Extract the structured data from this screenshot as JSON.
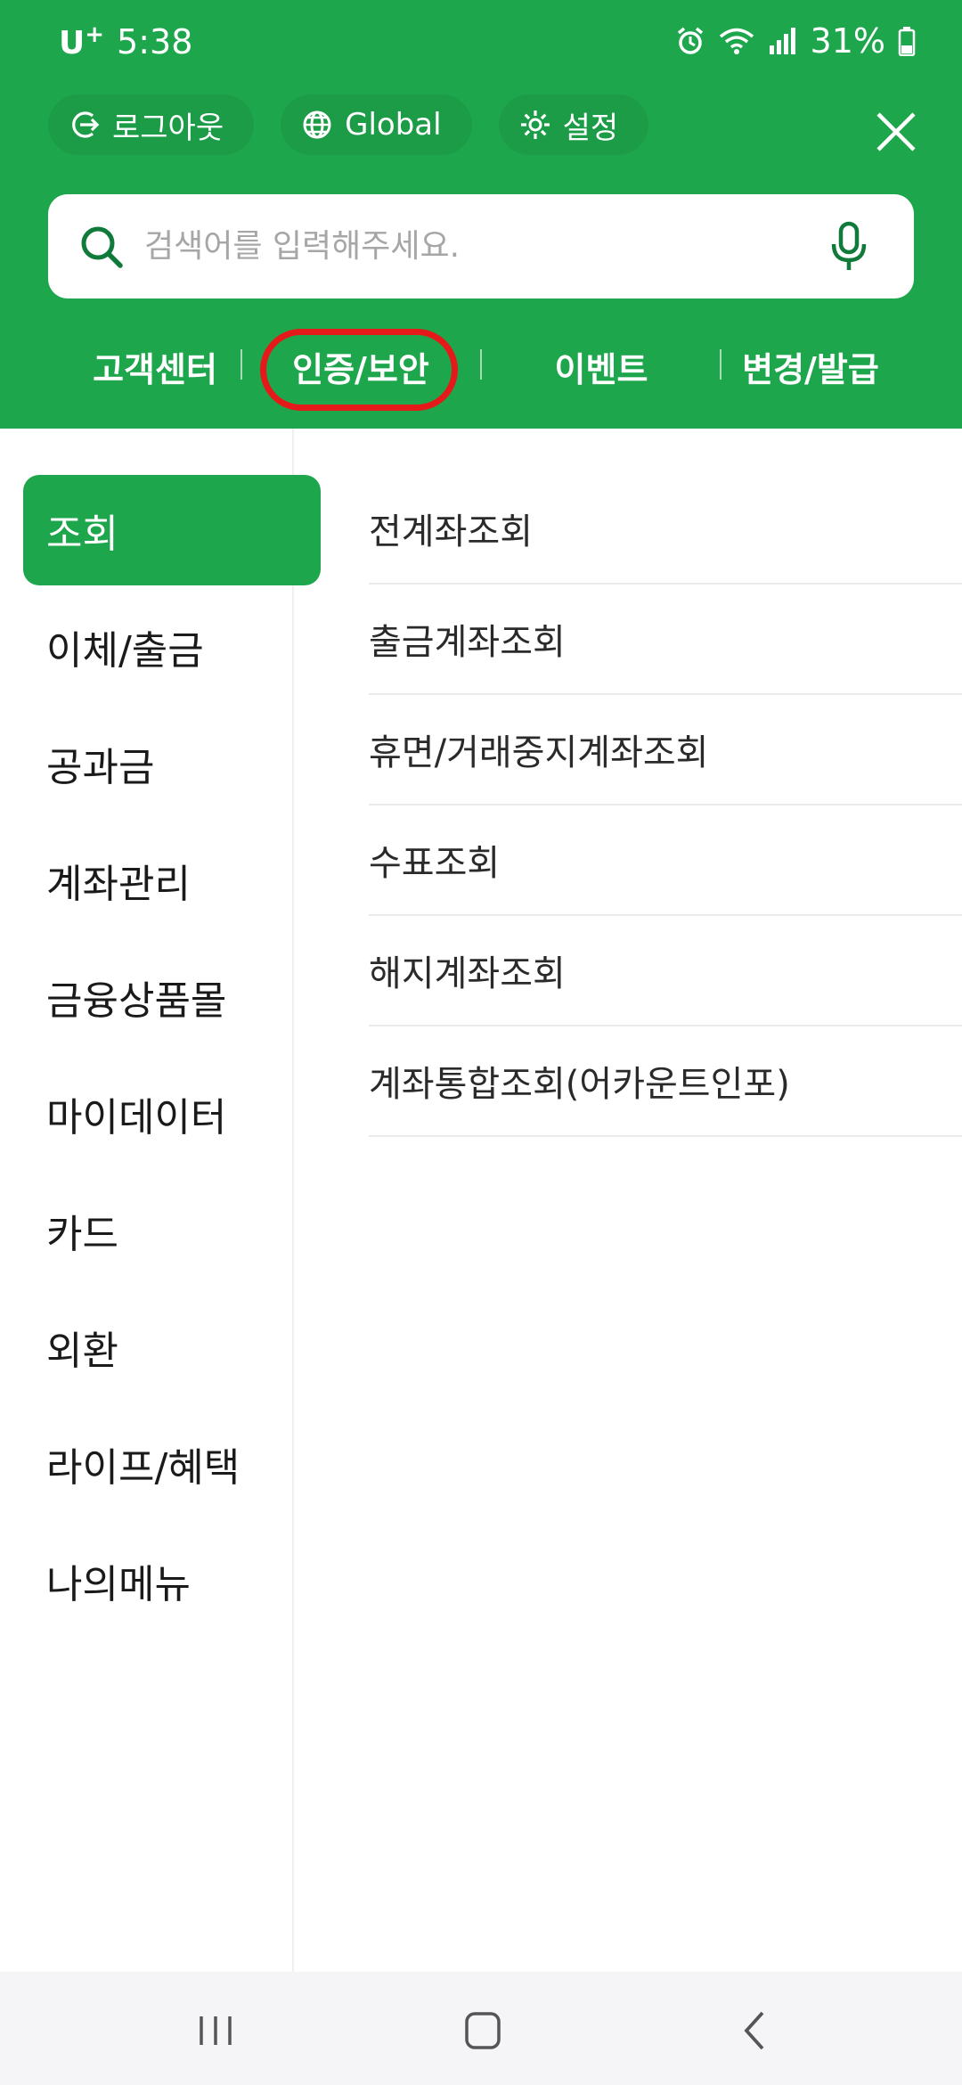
{
  "status_bar": {
    "carrier": "U",
    "carrier_sup": "+",
    "time": "5:38",
    "battery": "31%"
  },
  "quick_actions": {
    "logout": "로그아웃",
    "global": "Global",
    "settings": "설정"
  },
  "search": {
    "placeholder": "검색어를 입력해주세요."
  },
  "top_links": {
    "customer_center": "고객센터",
    "auth_security": "인증/보안",
    "event": "이벤트",
    "change_issue": "변경/발급"
  },
  "sidebar": {
    "items": [
      {
        "label": "조회"
      },
      {
        "label": "이체/출금"
      },
      {
        "label": "공과금"
      },
      {
        "label": "계좌관리"
      },
      {
        "label": "금융상품몰"
      },
      {
        "label": "마이데이터"
      },
      {
        "label": "카드"
      },
      {
        "label": "외환"
      },
      {
        "label": "라이프/혜택"
      },
      {
        "label": "나의메뉴"
      }
    ],
    "active_index": 0
  },
  "submenu": {
    "items": [
      {
        "label": "전계좌조회"
      },
      {
        "label": "출금계좌조회"
      },
      {
        "label": "휴면/거래중지계좌조회"
      },
      {
        "label": "수표조회"
      },
      {
        "label": "해지계좌조회"
      },
      {
        "label": "계좌통합조회(어카운트인포)"
      }
    ]
  },
  "colors": {
    "brand_green": "#1ea64c",
    "highlight_red": "#e51919"
  }
}
